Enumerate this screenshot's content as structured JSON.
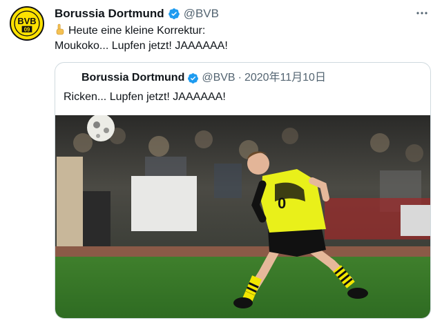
{
  "tweet": {
    "author_name": "Borussia Dortmund",
    "author_handle": "@BVB",
    "avatar_text": "BVB",
    "avatar_number": "09",
    "emoji": "☝",
    "text_line1": "Heute eine kleine Korrektur:",
    "text_line2": "Moukoko... Lupfen jetzt! JAAAAAA!",
    "more_icon": "more-horizontal-icon"
  },
  "quoted_tweet": {
    "author_name": "Borussia Dortmund",
    "author_handle": "@BVB",
    "separator": "·",
    "date": "2020年11月10日",
    "text": "Ricken... Lupfen jetzt! JAAAAAA!",
    "media": "photo"
  },
  "colors": {
    "verified": "#1d9bf0",
    "bvb_yellow": "#fde100",
    "secondary_text": "#536471",
    "border": "#cfd9de",
    "pitch_green": "#3f8a2c"
  }
}
